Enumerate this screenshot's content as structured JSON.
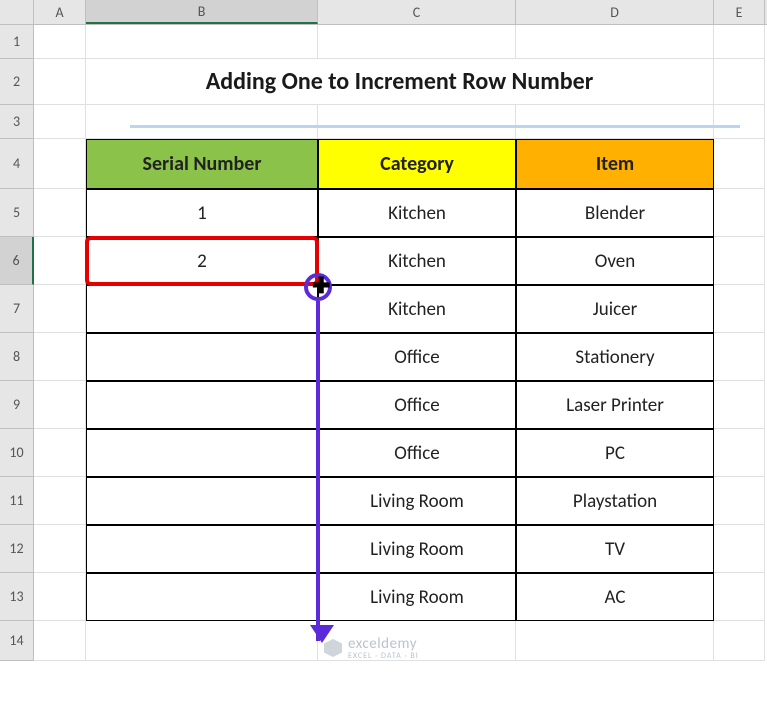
{
  "columns": {
    "A": "A",
    "B": "B",
    "C": "C",
    "D": "D",
    "E": "E"
  },
  "rows": [
    "1",
    "2",
    "3",
    "4",
    "5",
    "6",
    "7",
    "8",
    "9",
    "10",
    "11",
    "12",
    "13",
    "14"
  ],
  "title": "Adding One to Increment Row Number",
  "table": {
    "headers": {
      "serial": "Serial Number",
      "category": "Category",
      "item": "Item"
    },
    "rows": [
      {
        "serial": "1",
        "category": "Kitchen",
        "item": "Blender"
      },
      {
        "serial": "2",
        "category": "Kitchen",
        "item": "Oven"
      },
      {
        "serial": "",
        "category": "Kitchen",
        "item": "Juicer"
      },
      {
        "serial": "",
        "category": "Office",
        "item": "Stationery"
      },
      {
        "serial": "",
        "category": "Office",
        "item": "Laser Printer"
      },
      {
        "serial": "",
        "category": "Office",
        "item": "PC"
      },
      {
        "serial": "",
        "category": "Living Room",
        "item": "Playstation"
      },
      {
        "serial": "",
        "category": "Living Room",
        "item": "TV"
      },
      {
        "serial": "",
        "category": "Living Room",
        "item": "AC"
      }
    ]
  },
  "active_cell": "B6",
  "watermark": {
    "name": "exceldemy",
    "tagline": "EXCEL · DATA · BI"
  },
  "colors": {
    "header_green": "#8bc34a",
    "header_yellow": "#ffff00",
    "header_orange": "#ffb000",
    "title_rule": "#b9d5ef",
    "selection_red": "#e60000",
    "arrow_purple": "#5b2bd9"
  },
  "chart_data": {
    "type": "table",
    "title": "Adding One to Increment Row Number",
    "columns": [
      "Serial Number",
      "Category",
      "Item"
    ],
    "rows": [
      [
        1,
        "Kitchen",
        "Blender"
      ],
      [
        2,
        "Kitchen",
        "Oven"
      ],
      [
        null,
        "Kitchen",
        "Juicer"
      ],
      [
        null,
        "Office",
        "Stationery"
      ],
      [
        null,
        "Office",
        "Laser Printer"
      ],
      [
        null,
        "Office",
        "PC"
      ],
      [
        null,
        "Living Room",
        "Playstation"
      ],
      [
        null,
        "Living Room",
        "TV"
      ],
      [
        null,
        "Living Room",
        "AC"
      ]
    ]
  }
}
